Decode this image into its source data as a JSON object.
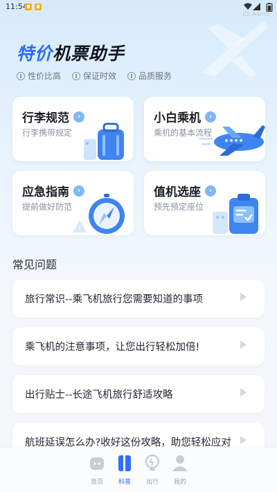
{
  "status_bar": {
    "time": "11:54",
    "watermark": "ID: Admin"
  },
  "header": {
    "title_accent": "特价",
    "title_rest": "机票助手",
    "features": [
      "性价比高",
      "保证时效",
      "品质服务"
    ]
  },
  "cards": [
    {
      "title": "行李规范",
      "desc": "行李携带规定"
    },
    {
      "title": "小白乘机",
      "desc": "乘机的基本流程"
    },
    {
      "title": "应急指南",
      "desc": "提前做好防范"
    },
    {
      "title": "值机选座",
      "desc": "预先预定座位"
    }
  ],
  "faq": {
    "section_title": "常见问题",
    "items": [
      "旅行常识--乘飞机旅行您需要知道的事项",
      "乘飞机的注意事项，让您出行轻松加倍!",
      "出行贴士--长途飞机旅行舒适攻略",
      "航班延误怎么办?收好这份攻略，助您轻松应对"
    ]
  },
  "tabbar": {
    "items": [
      {
        "label": "首页",
        "icon": "home-icon",
        "active": false
      },
      {
        "label": "科普",
        "icon": "book-icon",
        "active": true
      },
      {
        "label": "出行",
        "icon": "bulb-icon",
        "active": false
      },
      {
        "label": "我的",
        "icon": "person-icon",
        "active": false
      }
    ]
  },
  "colors": {
    "accent": "#2f6ef5",
    "chevron": "#7fb7f7"
  }
}
